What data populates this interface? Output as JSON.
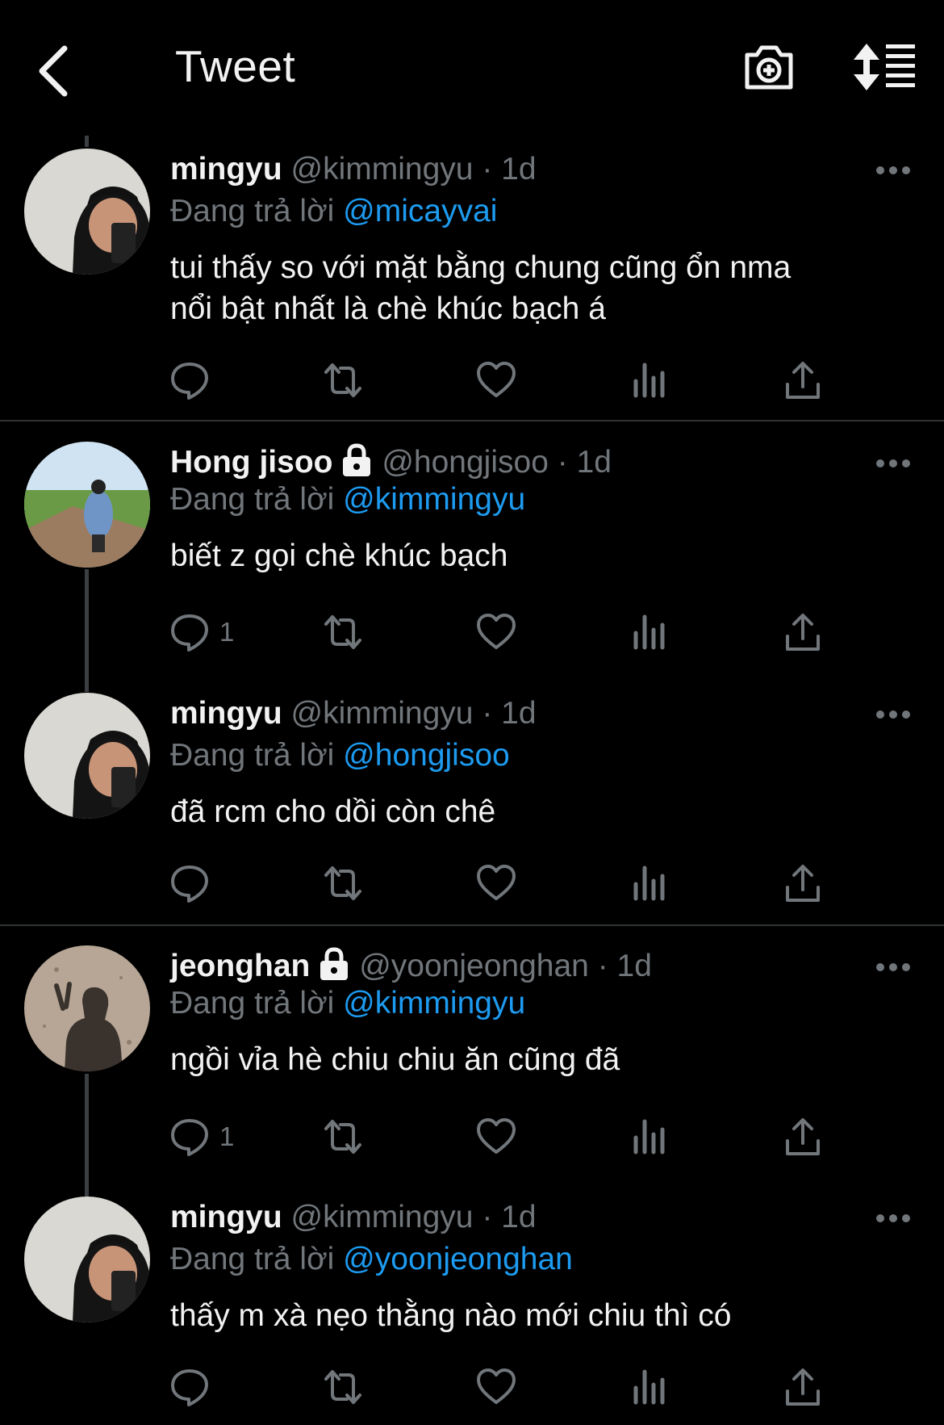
{
  "header": {
    "title": "Tweet"
  },
  "replying_prefix": "Đang trả lời",
  "dot_sep": "·",
  "colors": {
    "background": "#000000",
    "accent": "#1d9bf0",
    "muted": "#71767b"
  },
  "icons": {
    "back": "chevron-left-icon",
    "camera": "camera-plus-icon",
    "sort": "sort-icon"
  },
  "tweets": [
    {
      "name": "mingyu",
      "handle": "@kimmingyu",
      "time": "1d",
      "reply_to": "@micayvai",
      "text": [
        "tui thấy so với mặt bằng chung cũng ổn nma",
        "nổi bật nhất là chè khúc bạch á"
      ],
      "reply_count": "",
      "locked": false
    },
    {
      "name": "Hong jisoo",
      "handle": "@hongjisoo",
      "time": "1d",
      "reply_to": "@kimmingyu",
      "text": [
        "biết z gọi chè khúc bạch"
      ],
      "reply_count": "1",
      "locked": true
    },
    {
      "name": "mingyu",
      "handle": "@kimmingyu",
      "time": "1d",
      "reply_to": "@hongjisoo",
      "text": [
        "đã rcm cho dồi còn chê"
      ],
      "reply_count": "",
      "locked": false
    },
    {
      "name": "jeonghan",
      "handle": "@yoonjeonghan",
      "time": "1d",
      "reply_to": "@kimmingyu",
      "text": [
        "ngồi vỉa hè chiu chiu ăn cũng đã"
      ],
      "reply_count": "1",
      "locked": true
    },
    {
      "name": "mingyu",
      "handle": "@kimmingyu",
      "time": "1d",
      "reply_to": "@yoonjeonghan",
      "text": [
        "thấy m xà nẹo thằng nào mới chiu thì có"
      ],
      "reply_count": "",
      "locked": false
    }
  ]
}
